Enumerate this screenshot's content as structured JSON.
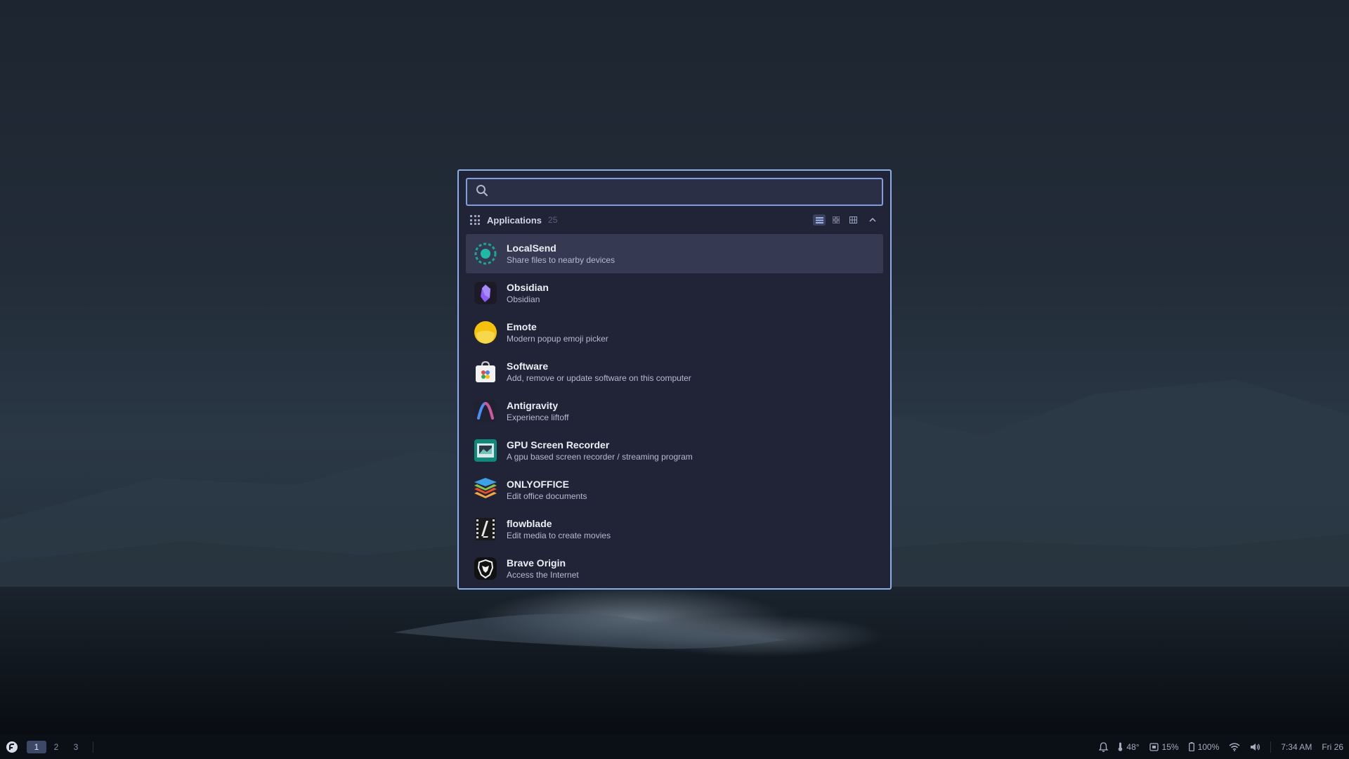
{
  "launcher": {
    "search": {
      "value": "",
      "placeholder": ""
    },
    "section": {
      "title": "Applications",
      "count": "25"
    },
    "apps": [
      {
        "name": "LocalSend",
        "description": "Share files to nearby devices",
        "icon": "localsend-icon",
        "selected": true
      },
      {
        "name": "Obsidian",
        "description": "Obsidian",
        "icon": "obsidian-icon"
      },
      {
        "name": "Emote",
        "description": "Modern popup emoji picker",
        "icon": "emote-icon"
      },
      {
        "name": "Software",
        "description": "Add, remove or update software on this computer",
        "icon": "software-icon"
      },
      {
        "name": "Antigravity",
        "description": "Experience liftoff",
        "icon": "antigravity-icon"
      },
      {
        "name": "GPU Screen Recorder",
        "description": "A gpu based screen recorder / streaming program",
        "icon": "gpu-screen-recorder-icon"
      },
      {
        "name": "ONLYOFFICE",
        "description": "Edit office documents",
        "icon": "onlyoffice-icon"
      },
      {
        "name": "flowblade",
        "description": "Edit media to create movies",
        "icon": "flowblade-icon"
      },
      {
        "name": "Brave Origin",
        "description": "Access the Internet",
        "icon": "brave-origin-icon"
      }
    ]
  },
  "taskbar": {
    "workspaces": [
      "1",
      "2",
      "3"
    ],
    "active_workspace": "1",
    "temperature": "48°",
    "cpu": "15%",
    "battery": "100%",
    "time": "7:34 AM",
    "date": "Fri 26"
  },
  "colors": {
    "accent": "#8aaee8",
    "launcher_bg": "#212437",
    "selected_row": "#353a52"
  }
}
